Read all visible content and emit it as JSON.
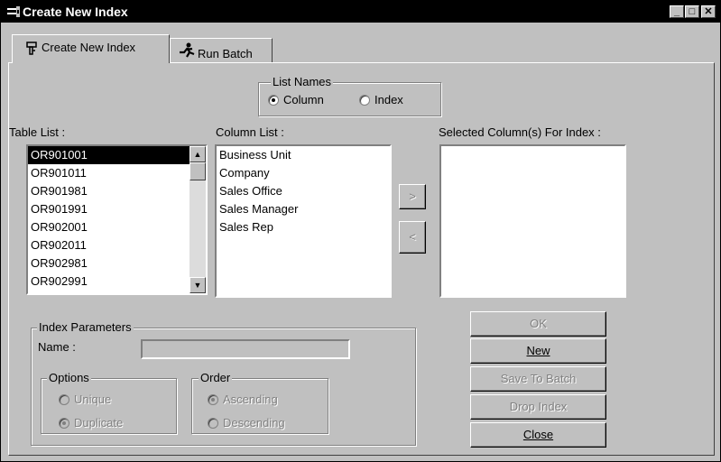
{
  "window": {
    "title": "Create New Index",
    "minimize": "_",
    "maximize": "□",
    "close": "✕"
  },
  "tabs": [
    {
      "label": "Create New Index",
      "icon": "index-icon",
      "active": true
    },
    {
      "label": "Run Batch",
      "icon": "runner-icon",
      "active": false
    }
  ],
  "list_names": {
    "legend": "List Names",
    "options": [
      {
        "label": "Column",
        "checked": true
      },
      {
        "label": "Index",
        "checked": false
      }
    ]
  },
  "table_list": {
    "label": "Table List :",
    "items": [
      "OR901001",
      "OR901011",
      "OR901981",
      "OR901991",
      "OR902001",
      "OR902011",
      "OR902981",
      "OR902991"
    ],
    "selected_index": 0
  },
  "column_list": {
    "label": "Column List :",
    "items": [
      "Business Unit",
      "Company",
      "Sales Office",
      "Sales Manager",
      "Sales Rep"
    ]
  },
  "move_buttons": {
    "add": ">",
    "remove": "<"
  },
  "selected_columns": {
    "label": "Selected Column(s) For Index :",
    "items": []
  },
  "index_parameters": {
    "legend": "Index Parameters",
    "name_label": "Name :",
    "name_value": "",
    "options": {
      "legend": "Options",
      "items": [
        {
          "label": "Unique",
          "checked": false
        },
        {
          "label": "Duplicate",
          "checked": true
        }
      ]
    },
    "order": {
      "legend": "Order",
      "items": [
        {
          "label": "Ascending",
          "checked": true
        },
        {
          "label": "Descending",
          "checked": false
        }
      ]
    }
  },
  "actions": {
    "ok": "OK",
    "new": "New",
    "save_to_batch": "Save To Batch",
    "drop_index": "Drop Index",
    "close": "Close"
  },
  "colors": {
    "face": "#c0c0c0",
    "titlebar": "#000000",
    "selection": "#000000",
    "disabled_text": "#808080"
  }
}
